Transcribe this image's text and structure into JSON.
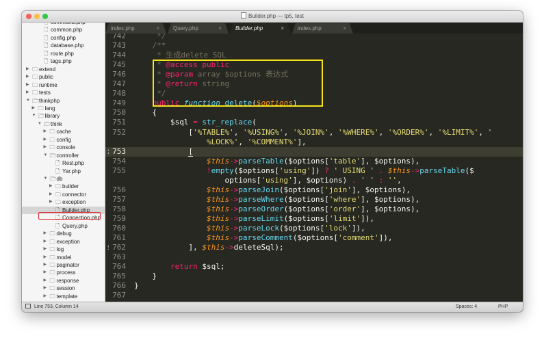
{
  "window": {
    "title": "Builder.php — tp5, test",
    "traffic_lights": [
      "#fc605b",
      "#fdbc40",
      "#34c84a"
    ]
  },
  "sidebar": {
    "items": [
      {
        "label": "command.php",
        "type": "file",
        "depth": 3
      },
      {
        "label": "common.php",
        "type": "file",
        "depth": 3
      },
      {
        "label": "config.php",
        "type": "file",
        "depth": 3
      },
      {
        "label": "database.php",
        "type": "file",
        "depth": 3
      },
      {
        "label": "route.php",
        "type": "file",
        "depth": 3
      },
      {
        "label": "tags.php",
        "type": "file",
        "depth": 3
      },
      {
        "label": "extend",
        "type": "folder",
        "depth": 1,
        "open": false
      },
      {
        "label": "public",
        "type": "folder",
        "depth": 1,
        "open": false
      },
      {
        "label": "runtime",
        "type": "folder",
        "depth": 1,
        "open": false
      },
      {
        "label": "tests",
        "type": "folder",
        "depth": 1,
        "open": false
      },
      {
        "label": "thinkphp",
        "type": "folder",
        "depth": 1,
        "open": true
      },
      {
        "label": "lang",
        "type": "folder",
        "depth": 2,
        "open": false
      },
      {
        "label": "library",
        "type": "folder",
        "depth": 2,
        "open": true
      },
      {
        "label": "think",
        "type": "folder",
        "depth": 3,
        "open": true
      },
      {
        "label": "cache",
        "type": "folder",
        "depth": 4,
        "open": false
      },
      {
        "label": "config",
        "type": "folder",
        "depth": 4,
        "open": false
      },
      {
        "label": "console",
        "type": "folder",
        "depth": 4,
        "open": false
      },
      {
        "label": "controller",
        "type": "folder",
        "depth": 4,
        "open": true
      },
      {
        "label": "Rest.php",
        "type": "file",
        "depth": 5
      },
      {
        "label": "Yar.php",
        "type": "file",
        "depth": 5
      },
      {
        "label": "db",
        "type": "folder",
        "depth": 4,
        "open": true
      },
      {
        "label": "builder",
        "type": "folder",
        "depth": 5,
        "open": false
      },
      {
        "label": "connector",
        "type": "folder",
        "depth": 5,
        "open": false
      },
      {
        "label": "exception",
        "type": "folder",
        "depth": 5,
        "open": false
      },
      {
        "label": "Builder.php",
        "type": "file",
        "depth": 5,
        "selected": true
      },
      {
        "label": "Connection.php",
        "type": "file",
        "depth": 5
      },
      {
        "label": "Query.php",
        "type": "file",
        "depth": 5
      },
      {
        "label": "debug",
        "type": "folder",
        "depth": 4,
        "open": false
      },
      {
        "label": "exception",
        "type": "folder",
        "depth": 4,
        "open": false
      },
      {
        "label": "log",
        "type": "folder",
        "depth": 4,
        "open": false
      },
      {
        "label": "model",
        "type": "folder",
        "depth": 4,
        "open": false
      },
      {
        "label": "paginator",
        "type": "folder",
        "depth": 4,
        "open": false
      },
      {
        "label": "process",
        "type": "folder",
        "depth": 4,
        "open": false
      },
      {
        "label": "response",
        "type": "folder",
        "depth": 4,
        "open": false
      },
      {
        "label": "session",
        "type": "folder",
        "depth": 4,
        "open": false
      },
      {
        "label": "template",
        "type": "folder",
        "depth": 4,
        "open": false
      },
      {
        "label": "view",
        "type": "folder",
        "depth": 4,
        "open": false
      }
    ]
  },
  "tabs": [
    {
      "label": "index.php",
      "active": false
    },
    {
      "label": "Query.php",
      "active": false
    },
    {
      "label": "Builder.php",
      "active": true
    },
    {
      "label": "index.php",
      "active": false
    }
  ],
  "tab_close_glyph": "×",
  "editor": {
    "current_line": "753",
    "lines": [
      {
        "n": "742",
        "tokens": [
          {
            "t": "c",
            "v": "     */"
          }
        ]
      },
      {
        "n": "743",
        "tokens": [
          {
            "t": "c",
            "v": "    /**"
          }
        ]
      },
      {
        "n": "744",
        "tokens": [
          {
            "t": "c",
            "v": "     * 生成delete SQL"
          }
        ]
      },
      {
        "n": "745",
        "tokens": [
          {
            "t": "c",
            "v": "     * "
          },
          {
            "t": "k",
            "v": "@access"
          },
          {
            "t": "p",
            "v": " "
          },
          {
            "t": "k",
            "v": "public"
          }
        ]
      },
      {
        "n": "746",
        "tokens": [
          {
            "t": "c",
            "v": "     * "
          },
          {
            "t": "k",
            "v": "@param"
          },
          {
            "t": "c",
            "v": " array $options 表达式"
          }
        ]
      },
      {
        "n": "747",
        "tokens": [
          {
            "t": "c",
            "v": "     * "
          },
          {
            "t": "k",
            "v": "@return"
          },
          {
            "t": "c",
            "v": " string"
          }
        ]
      },
      {
        "n": "748",
        "tokens": [
          {
            "t": "c",
            "v": "     */"
          }
        ]
      },
      {
        "n": "749",
        "tokens": [
          {
            "t": "p",
            "v": "    "
          },
          {
            "t": "k",
            "v": "public"
          },
          {
            "t": "p",
            "v": " "
          },
          {
            "t": "fi",
            "v": "function"
          },
          {
            "t": "p",
            "v": " "
          },
          {
            "t": "f",
            "v": "delete"
          },
          {
            "t": "p",
            "v": "("
          },
          {
            "t": "v",
            "v": "$options"
          },
          {
            "t": "p",
            "v": ")"
          }
        ]
      },
      {
        "n": "750",
        "tokens": [
          {
            "t": "p",
            "v": "    {"
          }
        ]
      },
      {
        "n": "751",
        "tokens": [
          {
            "t": "p",
            "v": "        $sql "
          },
          {
            "t": "k",
            "v": "="
          },
          {
            "t": "p",
            "v": " "
          },
          {
            "t": "f",
            "v": "str_replace"
          },
          {
            "t": "p",
            "v": "("
          }
        ]
      },
      {
        "n": "752",
        "tokens": [
          {
            "t": "p",
            "v": "            ["
          },
          {
            "t": "s",
            "v": "'%TABLE%'"
          },
          {
            "t": "p",
            "v": ", "
          },
          {
            "t": "s",
            "v": "'%USING%'"
          },
          {
            "t": "p",
            "v": ", "
          },
          {
            "t": "s",
            "v": "'%JOIN%'"
          },
          {
            "t": "p",
            "v": ", "
          },
          {
            "t": "s",
            "v": "'%WHERE%'"
          },
          {
            "t": "p",
            "v": ", "
          },
          {
            "t": "s",
            "v": "'%ORDER%'"
          },
          {
            "t": "p",
            "v": ", "
          },
          {
            "t": "s",
            "v": "'%LIMIT%'"
          },
          {
            "t": "p",
            "v": ", "
          },
          {
            "t": "s",
            "v": "'"
          }
        ]
      },
      {
        "n": "",
        "tokens": [
          {
            "t": "s",
            "v": "                %LOCK%'"
          },
          {
            "t": "p",
            "v": ", "
          },
          {
            "t": "s",
            "v": "'%COMMENT%'"
          },
          {
            "t": "p",
            "v": "],"
          }
        ]
      },
      {
        "n": "753",
        "tokens": [
          {
            "t": "p",
            "v": "            "
          },
          {
            "t": "cur",
            "v": "["
          }
        ]
      },
      {
        "n": "754",
        "tokens": [
          {
            "t": "p",
            "v": "                "
          },
          {
            "t": "v",
            "v": "$this"
          },
          {
            "t": "k",
            "v": "->"
          },
          {
            "t": "f",
            "v": "parseTable"
          },
          {
            "t": "p",
            "v": "($options["
          },
          {
            "t": "s",
            "v": "'table'"
          },
          {
            "t": "p",
            "v": "], $options),"
          }
        ]
      },
      {
        "n": "755",
        "tokens": [
          {
            "t": "p",
            "v": "                "
          },
          {
            "t": "k",
            "v": "!"
          },
          {
            "t": "f",
            "v": "empty"
          },
          {
            "t": "p",
            "v": "($options["
          },
          {
            "t": "s",
            "v": "'using'"
          },
          {
            "t": "p",
            "v": "]) "
          },
          {
            "t": "k",
            "v": "?"
          },
          {
            "t": "p",
            "v": " "
          },
          {
            "t": "s",
            "v": "' USING '"
          },
          {
            "t": "p",
            "v": " "
          },
          {
            "t": "k",
            "v": "."
          },
          {
            "t": "p",
            "v": " "
          },
          {
            "t": "v",
            "v": "$this"
          },
          {
            "t": "k",
            "v": "->"
          },
          {
            "t": "f",
            "v": "parseTable"
          },
          {
            "t": "p",
            "v": "($"
          }
        ]
      },
      {
        "n": "",
        "tokens": [
          {
            "t": "p",
            "v": "                    options["
          },
          {
            "t": "s",
            "v": "'using'"
          },
          {
            "t": "p",
            "v": "], $options) "
          },
          {
            "t": "k",
            "v": "."
          },
          {
            "t": "p",
            "v": " "
          },
          {
            "t": "s",
            "v": "' '"
          },
          {
            "t": "p",
            "v": " "
          },
          {
            "t": "k",
            "v": ":"
          },
          {
            "t": "p",
            "v": " "
          },
          {
            "t": "s",
            "v": "''"
          },
          {
            "t": "p",
            "v": ","
          }
        ]
      },
      {
        "n": "756",
        "tokens": [
          {
            "t": "p",
            "v": "                "
          },
          {
            "t": "v",
            "v": "$this"
          },
          {
            "t": "k",
            "v": "->"
          },
          {
            "t": "f",
            "v": "parseJoin"
          },
          {
            "t": "p",
            "v": "($options["
          },
          {
            "t": "s",
            "v": "'join'"
          },
          {
            "t": "p",
            "v": "], $options),"
          }
        ]
      },
      {
        "n": "757",
        "tokens": [
          {
            "t": "p",
            "v": "                "
          },
          {
            "t": "v",
            "v": "$this"
          },
          {
            "t": "k",
            "v": "->"
          },
          {
            "t": "f",
            "v": "parseWhere"
          },
          {
            "t": "p",
            "v": "($options["
          },
          {
            "t": "s",
            "v": "'where'"
          },
          {
            "t": "p",
            "v": "], $options),"
          }
        ]
      },
      {
        "n": "758",
        "tokens": [
          {
            "t": "p",
            "v": "                "
          },
          {
            "t": "v",
            "v": "$this"
          },
          {
            "t": "k",
            "v": "->"
          },
          {
            "t": "f",
            "v": "parseOrder"
          },
          {
            "t": "p",
            "v": "($options["
          },
          {
            "t": "s",
            "v": "'order'"
          },
          {
            "t": "p",
            "v": "], $options),"
          }
        ]
      },
      {
        "n": "759",
        "tokens": [
          {
            "t": "p",
            "v": "                "
          },
          {
            "t": "v",
            "v": "$this"
          },
          {
            "t": "k",
            "v": "->"
          },
          {
            "t": "f",
            "v": "parseLimit"
          },
          {
            "t": "p",
            "v": "($options["
          },
          {
            "t": "s",
            "v": "'limit'"
          },
          {
            "t": "p",
            "v": "]),"
          }
        ]
      },
      {
        "n": "760",
        "tokens": [
          {
            "t": "p",
            "v": "                "
          },
          {
            "t": "v",
            "v": "$this"
          },
          {
            "t": "k",
            "v": "->"
          },
          {
            "t": "f",
            "v": "parseLock"
          },
          {
            "t": "p",
            "v": "($options["
          },
          {
            "t": "s",
            "v": "'lock'"
          },
          {
            "t": "p",
            "v": "]),"
          }
        ]
      },
      {
        "n": "761",
        "tokens": [
          {
            "t": "p",
            "v": "                "
          },
          {
            "t": "v",
            "v": "$this"
          },
          {
            "t": "k",
            "v": "->"
          },
          {
            "t": "f",
            "v": "parseComment"
          },
          {
            "t": "p",
            "v": "($options["
          },
          {
            "t": "s",
            "v": "'comment'"
          },
          {
            "t": "p",
            "v": "]),"
          }
        ]
      },
      {
        "n": "762",
        "tokens": [
          {
            "t": "p",
            "v": "            ], "
          },
          {
            "t": "v",
            "v": "$this"
          },
          {
            "t": "k",
            "v": "->"
          },
          {
            "t": "p",
            "v": "deleteSql);"
          }
        ]
      },
      {
        "n": "763",
        "tokens": [
          {
            "t": "p",
            "v": ""
          }
        ]
      },
      {
        "n": "764",
        "tokens": [
          {
            "t": "p",
            "v": "        "
          },
          {
            "t": "k",
            "v": "return"
          },
          {
            "t": "p",
            "v": " $sql;"
          }
        ]
      },
      {
        "n": "765",
        "tokens": [
          {
            "t": "p",
            "v": "    }"
          }
        ]
      },
      {
        "n": "766",
        "tokens": [
          {
            "t": "p",
            "v": "}"
          }
        ]
      },
      {
        "n": "767",
        "tokens": [
          {
            "t": "p",
            "v": ""
          }
        ]
      }
    ]
  },
  "statusbar": {
    "position": "Line 753, Column 14",
    "spaces": "Spaces: 4",
    "syntax": "PHP"
  }
}
